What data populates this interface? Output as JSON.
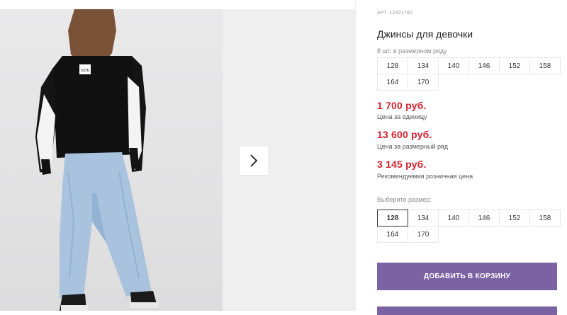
{
  "product": {
    "article": "АРТ. 12421782",
    "title": "Джинсы для девочки",
    "pack_note": "8 шт. в размерном ряду",
    "pack_sizes": [
      "128",
      "134",
      "140",
      "146",
      "152",
      "158",
      "164",
      "170"
    ],
    "prices": [
      {
        "value": "1 700 руб.",
        "note": "Цена за единицу"
      },
      {
        "value": "13 600 руб.",
        "note": "Цена за размерный ряд"
      },
      {
        "value": "3 145 руб.",
        "note": "Рекомендуемая розничная цена"
      }
    ],
    "select_label": "Выберите размер:",
    "select_sizes": [
      "128",
      "134",
      "140",
      "146",
      "152",
      "158",
      "164",
      "170"
    ],
    "selected_size": "128",
    "add_to_cart_label": "ДОБАВИТЬ В КОРЗИНУ"
  },
  "gallery": {
    "next_icon": "chevron-right-icon",
    "print_text": "ЪОЪ"
  },
  "colors": {
    "price": "#d2222e",
    "accent_button": "#7b62a3"
  }
}
